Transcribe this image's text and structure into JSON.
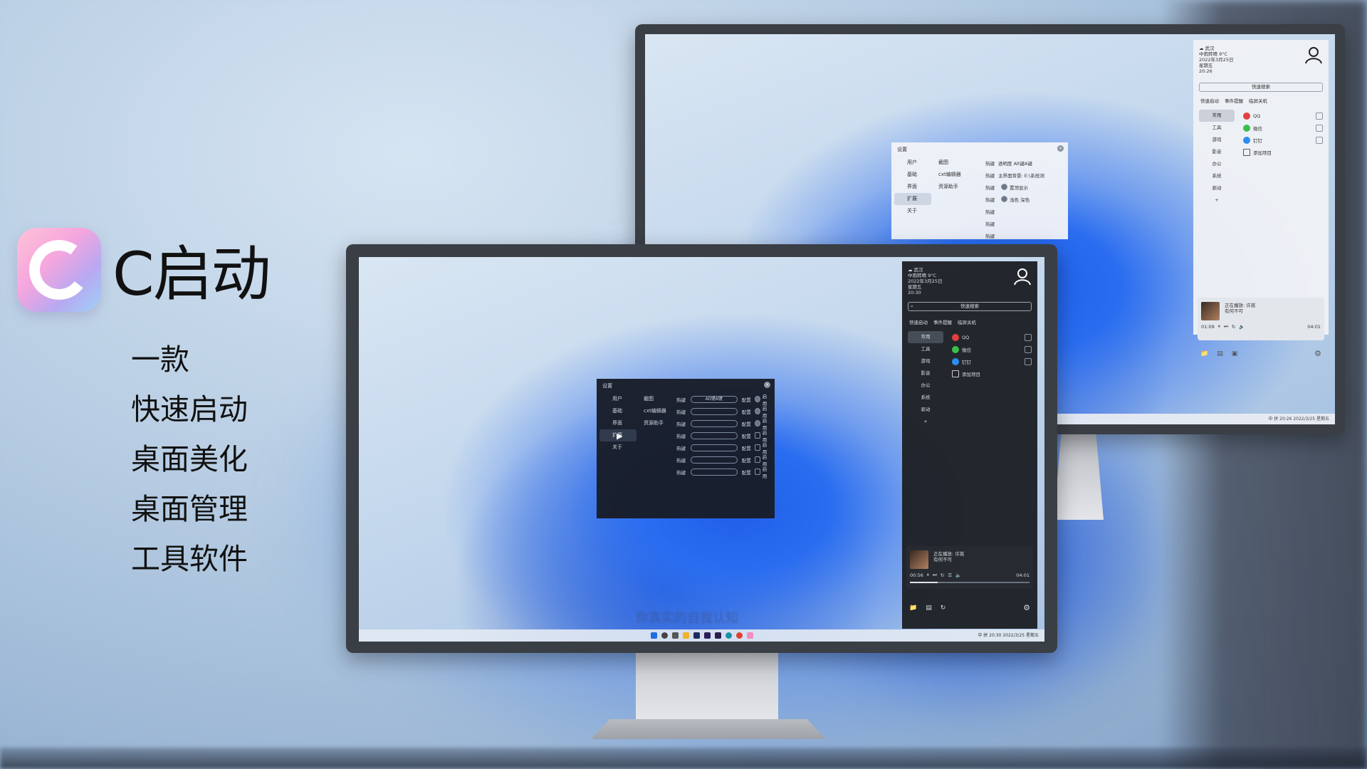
{
  "brand": {
    "app_name": "C启动",
    "features": [
      "一款",
      "快速启动",
      "桌面美化",
      "桌面管理",
      "工具软件"
    ]
  },
  "settings": {
    "title": "设置",
    "nav": [
      "用户",
      "基础",
      "界面",
      "扩展",
      "关于"
    ],
    "sub": [
      "截图",
      "cxt编辑器",
      "资源助手"
    ],
    "hotkey_label": "热键",
    "config_label": "配置",
    "enable_label": "启用",
    "first_hotkey": "Alt键A键",
    "light_rows": [
      "透明度 Alt键A键",
      "主界面背景: E:\\系统测",
      "置顶显示",
      "浅色  深色"
    ]
  },
  "panel": {
    "weather_city": "武汉",
    "weather_desc": "中雨转晴",
    "weather_temp": "9°C",
    "date": "2022年3月25日",
    "weekday": "星期五",
    "time_front": "20:30",
    "time_back": "20:26",
    "search_placeholder": "快速搜索",
    "tabs": [
      "快速启动",
      "事件提醒",
      "临屏关机"
    ],
    "categories": [
      "常用",
      "工具",
      "游戏",
      "影音",
      "办公",
      "系统",
      "驱动",
      "+"
    ],
    "items": [
      "QQ",
      "微信",
      "钉钉",
      "添加项目"
    ],
    "now_playing_label": "正在播放: 许嵩",
    "song": "有何不可",
    "elapsed_front": "00:56",
    "elapsed_back": "01:09",
    "duration": "04:01",
    "progress_front": 0.23,
    "progress_back": 0.29
  },
  "taskbar": {
    "tray_front": "中 拼 20:30 2022/3/25 星期五",
    "tray_back": "中 拼 20:26 2022/3/25 星期五"
  },
  "subtitle": "你真实的自我认知",
  "colors": {
    "accent_blue": "#2a6df0",
    "dark_panel": "#1e2126",
    "light_panel": "#eef1f5"
  }
}
